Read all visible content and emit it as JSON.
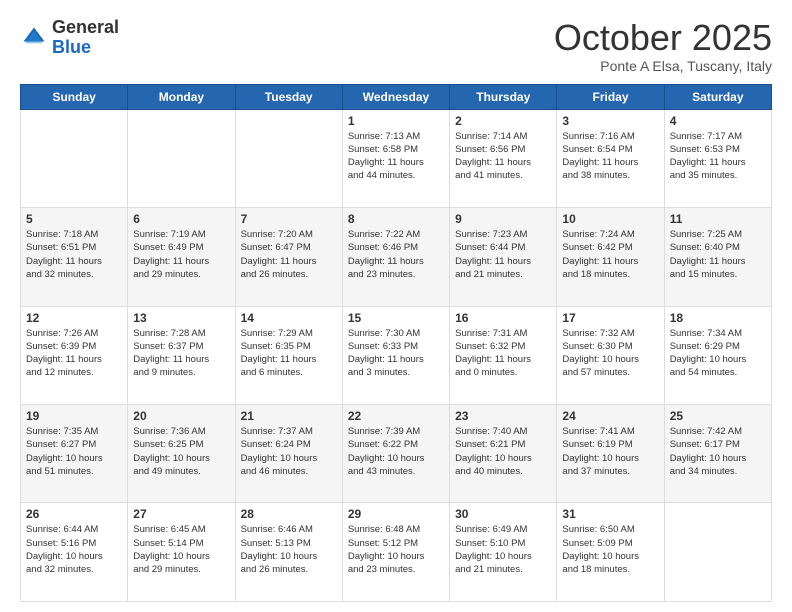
{
  "header": {
    "logo_general": "General",
    "logo_blue": "Blue",
    "month_title": "October 2025",
    "location": "Ponte A Elsa, Tuscany, Italy"
  },
  "days_of_week": [
    "Sunday",
    "Monday",
    "Tuesday",
    "Wednesday",
    "Thursday",
    "Friday",
    "Saturday"
  ],
  "weeks": [
    [
      {
        "day": "",
        "info": ""
      },
      {
        "day": "",
        "info": ""
      },
      {
        "day": "",
        "info": ""
      },
      {
        "day": "1",
        "info": "Sunrise: 7:13 AM\nSunset: 6:58 PM\nDaylight: 11 hours\nand 44 minutes."
      },
      {
        "day": "2",
        "info": "Sunrise: 7:14 AM\nSunset: 6:56 PM\nDaylight: 11 hours\nand 41 minutes."
      },
      {
        "day": "3",
        "info": "Sunrise: 7:16 AM\nSunset: 6:54 PM\nDaylight: 11 hours\nand 38 minutes."
      },
      {
        "day": "4",
        "info": "Sunrise: 7:17 AM\nSunset: 6:53 PM\nDaylight: 11 hours\nand 35 minutes."
      }
    ],
    [
      {
        "day": "5",
        "info": "Sunrise: 7:18 AM\nSunset: 6:51 PM\nDaylight: 11 hours\nand 32 minutes."
      },
      {
        "day": "6",
        "info": "Sunrise: 7:19 AM\nSunset: 6:49 PM\nDaylight: 11 hours\nand 29 minutes."
      },
      {
        "day": "7",
        "info": "Sunrise: 7:20 AM\nSunset: 6:47 PM\nDaylight: 11 hours\nand 26 minutes."
      },
      {
        "day": "8",
        "info": "Sunrise: 7:22 AM\nSunset: 6:46 PM\nDaylight: 11 hours\nand 23 minutes."
      },
      {
        "day": "9",
        "info": "Sunrise: 7:23 AM\nSunset: 6:44 PM\nDaylight: 11 hours\nand 21 minutes."
      },
      {
        "day": "10",
        "info": "Sunrise: 7:24 AM\nSunset: 6:42 PM\nDaylight: 11 hours\nand 18 minutes."
      },
      {
        "day": "11",
        "info": "Sunrise: 7:25 AM\nSunset: 6:40 PM\nDaylight: 11 hours\nand 15 minutes."
      }
    ],
    [
      {
        "day": "12",
        "info": "Sunrise: 7:26 AM\nSunset: 6:39 PM\nDaylight: 11 hours\nand 12 minutes."
      },
      {
        "day": "13",
        "info": "Sunrise: 7:28 AM\nSunset: 6:37 PM\nDaylight: 11 hours\nand 9 minutes."
      },
      {
        "day": "14",
        "info": "Sunrise: 7:29 AM\nSunset: 6:35 PM\nDaylight: 11 hours\nand 6 minutes."
      },
      {
        "day": "15",
        "info": "Sunrise: 7:30 AM\nSunset: 6:33 PM\nDaylight: 11 hours\nand 3 minutes."
      },
      {
        "day": "16",
        "info": "Sunrise: 7:31 AM\nSunset: 6:32 PM\nDaylight: 11 hours\nand 0 minutes."
      },
      {
        "day": "17",
        "info": "Sunrise: 7:32 AM\nSunset: 6:30 PM\nDaylight: 10 hours\nand 57 minutes."
      },
      {
        "day": "18",
        "info": "Sunrise: 7:34 AM\nSunset: 6:29 PM\nDaylight: 10 hours\nand 54 minutes."
      }
    ],
    [
      {
        "day": "19",
        "info": "Sunrise: 7:35 AM\nSunset: 6:27 PM\nDaylight: 10 hours\nand 51 minutes."
      },
      {
        "day": "20",
        "info": "Sunrise: 7:36 AM\nSunset: 6:25 PM\nDaylight: 10 hours\nand 49 minutes."
      },
      {
        "day": "21",
        "info": "Sunrise: 7:37 AM\nSunset: 6:24 PM\nDaylight: 10 hours\nand 46 minutes."
      },
      {
        "day": "22",
        "info": "Sunrise: 7:39 AM\nSunset: 6:22 PM\nDaylight: 10 hours\nand 43 minutes."
      },
      {
        "day": "23",
        "info": "Sunrise: 7:40 AM\nSunset: 6:21 PM\nDaylight: 10 hours\nand 40 minutes."
      },
      {
        "day": "24",
        "info": "Sunrise: 7:41 AM\nSunset: 6:19 PM\nDaylight: 10 hours\nand 37 minutes."
      },
      {
        "day": "25",
        "info": "Sunrise: 7:42 AM\nSunset: 6:17 PM\nDaylight: 10 hours\nand 34 minutes."
      }
    ],
    [
      {
        "day": "26",
        "info": "Sunrise: 6:44 AM\nSunset: 5:16 PM\nDaylight: 10 hours\nand 32 minutes."
      },
      {
        "day": "27",
        "info": "Sunrise: 6:45 AM\nSunset: 5:14 PM\nDaylight: 10 hours\nand 29 minutes."
      },
      {
        "day": "28",
        "info": "Sunrise: 6:46 AM\nSunset: 5:13 PM\nDaylight: 10 hours\nand 26 minutes."
      },
      {
        "day": "29",
        "info": "Sunrise: 6:48 AM\nSunset: 5:12 PM\nDaylight: 10 hours\nand 23 minutes."
      },
      {
        "day": "30",
        "info": "Sunrise: 6:49 AM\nSunset: 5:10 PM\nDaylight: 10 hours\nand 21 minutes."
      },
      {
        "day": "31",
        "info": "Sunrise: 6:50 AM\nSunset: 5:09 PM\nDaylight: 10 hours\nand 18 minutes."
      },
      {
        "day": "",
        "info": ""
      }
    ]
  ]
}
